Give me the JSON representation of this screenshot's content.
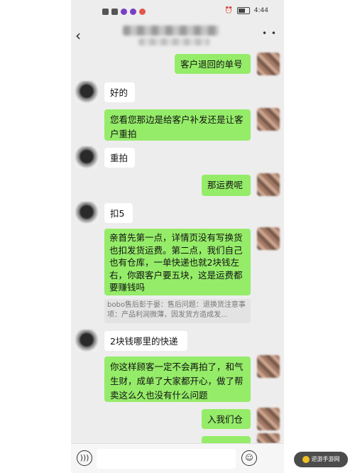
{
  "status_bar": {
    "time": "4:44"
  },
  "messages": [
    {
      "side": "right",
      "text": "客户退回的单号"
    },
    {
      "side": "left",
      "text": "好的"
    },
    {
      "side": "right",
      "text": "您看您那边是给客户补发还是让客户重拍"
    },
    {
      "side": "left",
      "text": "重拍"
    },
    {
      "side": "right",
      "text": "那运费呢"
    },
    {
      "side": "left",
      "text": "扣5"
    },
    {
      "side": "right",
      "text": "亲首先第一点，详情页没有写换货也扣发货运费。第二点，我们自己也有仓库，一单快递也就2块钱左右，你跟客户要五块，这是运费都要赚钱吗",
      "quote": "bobo售后彭于晏：售后问题：退换货注意事项：产品利润微薄，因发货方造成发..."
    },
    {
      "side": "left",
      "text": "2块钱哪里的快递"
    },
    {
      "side": "right",
      "text": "你这样顾客一定不会再拍了，和气生财，成单了大家都开心，做了帮卖这么久也没有什么问题"
    },
    {
      "side": "right",
      "text": "入我们仓"
    }
  ],
  "watermark": {
    "text": "逆游手游网"
  }
}
